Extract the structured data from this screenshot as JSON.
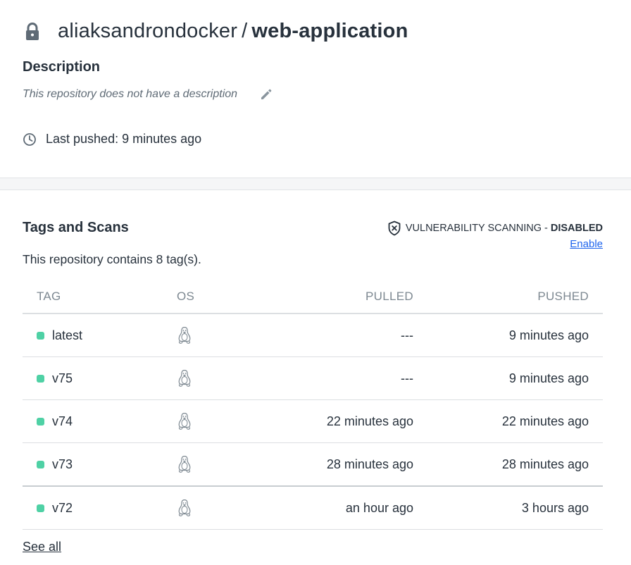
{
  "repo": {
    "namespace": "aliaksandrondocker",
    "separator": "/",
    "name": "web-application"
  },
  "description": {
    "heading": "Description",
    "text": "This repository does not have a description"
  },
  "last_pushed": "Last pushed: 9 minutes ago",
  "tags_section": {
    "heading": "Tags and Scans",
    "vuln_label": "VULNERABILITY SCANNING -",
    "vuln_status": "DISABLED",
    "enable_label": "Enable",
    "count_text": "This repository contains 8 tag(s).",
    "columns": {
      "tag": "TAG",
      "os": "OS",
      "pulled": "PULLED",
      "pushed": "PUSHED"
    },
    "rows": [
      {
        "tag": "latest",
        "os": "linux-icon",
        "pulled": "---",
        "pushed": "9 minutes ago"
      },
      {
        "tag": "v75",
        "os": "linux-icon",
        "pulled": "---",
        "pushed": "9 minutes ago"
      },
      {
        "tag": "v74",
        "os": "linux-icon",
        "pulled": "22 minutes ago",
        "pushed": "22 minutes ago"
      },
      {
        "tag": "v73",
        "os": "linux-icon",
        "pulled": "28 minutes ago",
        "pushed": "28 minutes ago"
      },
      {
        "tag": "v72",
        "os": "linux-icon",
        "pulled": "an hour ago",
        "pushed": "3 hours ago"
      }
    ],
    "see_all": "See all"
  },
  "colors": {
    "text": "#27313c",
    "muted": "#7d8891",
    "link": "#1d63ed",
    "tag_dot": "#4fd1a5"
  }
}
